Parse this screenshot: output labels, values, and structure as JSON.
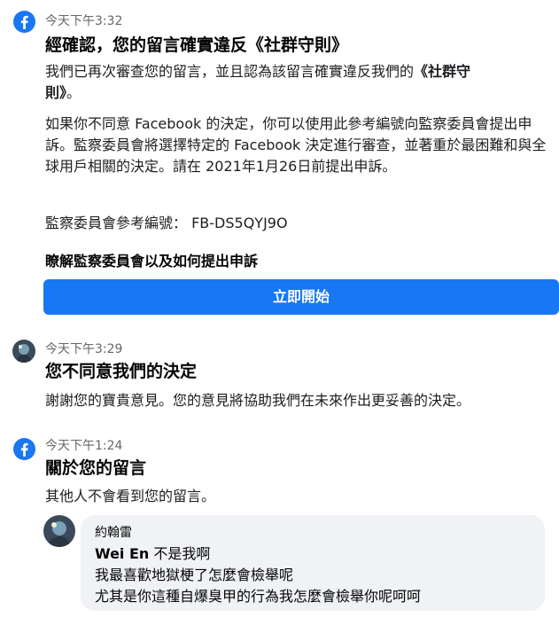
{
  "messages": [
    {
      "time": "今天下午3:32",
      "title": "經確認，您的留言確實違反《社群守則》",
      "para1_a": "我們已再次審查您的留言，並且認為該留言確實違反我們的",
      "para1_b": "《社群守",
      "para1_c": "則》",
      "para1_d": "。",
      "para2": "如果你不同意 Facebook 的決定，你可以使用此參考編號向監察委員會提出申訴。監察委員會將選擇特定的 Facebook 決定進行審查，並著重於最困難和與全球用戶相關的決定。請在 2021年1月26日前提出申訴。",
      "reference": "監察委員會參考編號：  FB-DS5QYJ9O",
      "learn_more": "瞭解監察委員會以及如何提出申訴",
      "button": "立即開始"
    },
    {
      "time": "今天下午3:29",
      "title": "您不同意我們的決定",
      "body": "謝謝您的寶貴意見。您的意見將協助我們在未來作出更妥善的決定。"
    },
    {
      "time": "今天下午1:24",
      "title": "關於您的留言",
      "body": "其他人不會看到您的留言。"
    }
  ],
  "comment": {
    "author": "約翰雷",
    "mention": "Wei En",
    "line1_rest": " 不是我啊",
    "line2": "我最喜歡地獄梗了怎麼會檢舉呢",
    "line3": "尤其是你這種自爆臭甲的行為我怎麼會檢舉你呢呵呵"
  },
  "colors": {
    "facebook_blue": "#1877f2",
    "timestamp_gray": "#65676b",
    "bubble_gray": "#f0f2f5"
  },
  "icons": [
    "facebook-icon",
    "user-avatar"
  ]
}
